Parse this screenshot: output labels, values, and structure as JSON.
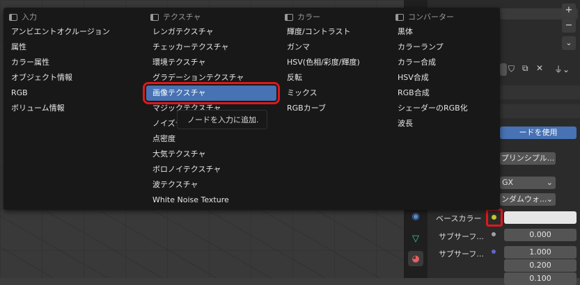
{
  "menu": {
    "columns": [
      {
        "header": "入力",
        "items": [
          "アンビエントオクルージョン",
          "属性",
          "カラー属性",
          "オブジェクト情報",
          "RGB",
          "ボリューム情報"
        ]
      },
      {
        "header": "テクスチャ",
        "items": [
          "レンガテクスチャ",
          "チェッカーテクスチャ",
          "環境テクスチャ",
          "グラデーションテクスチャ",
          "画像テクスチャ",
          "マジックテクスチャ",
          "ノイズテクスチャ",
          "点密度",
          "大気テクスチャ",
          "ボロノイテクスチャ",
          "波テクスチャ",
          "White Noise Texture"
        ],
        "active_index": 4
      },
      {
        "header": "カラー",
        "items": [
          "輝度/コントラスト",
          "ガンマ",
          "HSV(色相/彩度/輝度)",
          "反転",
          "ミックス",
          "RGBカーブ"
        ]
      },
      {
        "header": "コンバーター",
        "items": [
          "黒体",
          "カラーランプ",
          "カラー合成",
          "HSV合成",
          "RGB合成",
          "シェーダーのRGB化",
          "波長"
        ]
      }
    ],
    "tooltip": "ノードを入力に追加."
  },
  "props": {
    "use_nodes_label": "ードを使用",
    "shader_label": "プリンシプル...",
    "distribution_value": "GX",
    "subsurface_method_value": "ンダムウォ...",
    "rows": [
      {
        "label": "ベースカラー",
        "value": ""
      },
      {
        "label": "サブサーフ...",
        "value": "0.000"
      },
      {
        "label": "サブサーフ...",
        "value": "1.000"
      },
      {
        "label": "",
        "value": "0.200"
      },
      {
        "label": "",
        "value": "0.100"
      }
    ],
    "plus_label": "+",
    "minus_label": "−",
    "chevron_label": "⌄"
  },
  "colors": {
    "accent_blue": "#4772b3",
    "highlight_red": "#e0181b",
    "socket_yellow": "#c7c729",
    "socket_purple": "#6363c7",
    "socket_gray": "#a1a1a1"
  }
}
